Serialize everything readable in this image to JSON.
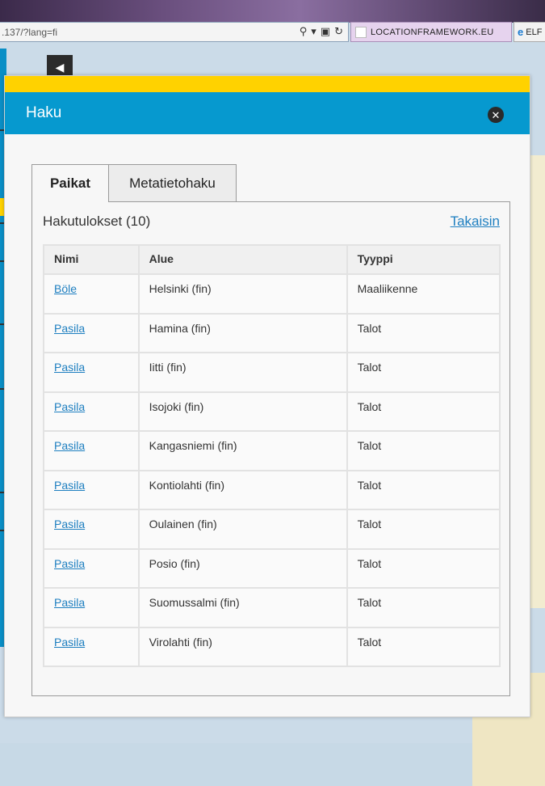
{
  "browser": {
    "address_text": ".137/?lang=fi",
    "tab1_title": "LOCATIONFRAMEWORK.EU",
    "tab2_title": "ELF"
  },
  "dialog": {
    "title": "Haku",
    "close_symbol": "✕"
  },
  "tabs": [
    {
      "label": "Paikat",
      "active": true
    },
    {
      "label": "Metatietohaku",
      "active": false
    }
  ],
  "results": {
    "title": "Hakutulokset (10)",
    "back_label": "Takaisin",
    "columns": [
      "Nimi",
      "Alue",
      "Tyyppi"
    ],
    "rows": [
      {
        "name": "Böle",
        "area": "Helsinki (fin)",
        "type": "Maaliikenne"
      },
      {
        "name": "Pasila",
        "area": "Hamina (fin)",
        "type": "Talot"
      },
      {
        "name": "Pasila",
        "area": "Iitti (fin)",
        "type": "Talot"
      },
      {
        "name": "Pasila",
        "area": "Isojoki (fin)",
        "type": "Talot"
      },
      {
        "name": "Pasila",
        "area": "Kangasniemi (fin)",
        "type": "Talot"
      },
      {
        "name": "Pasila",
        "area": "Kontiolahti (fin)",
        "type": "Talot"
      },
      {
        "name": "Pasila",
        "area": "Oulainen (fin)",
        "type": "Talot"
      },
      {
        "name": "Pasila",
        "area": "Posio (fin)",
        "type": "Talot"
      },
      {
        "name": "Pasila",
        "area": "Suomussalmi (fin)",
        "type": "Talot"
      },
      {
        "name": "Pasila",
        "area": "Virolahti (fin)",
        "type": "Talot"
      }
    ]
  },
  "colors": {
    "header_blue": "#0699cf",
    "accent_yellow": "#ffd200",
    "link_blue": "#1e7fc0"
  }
}
